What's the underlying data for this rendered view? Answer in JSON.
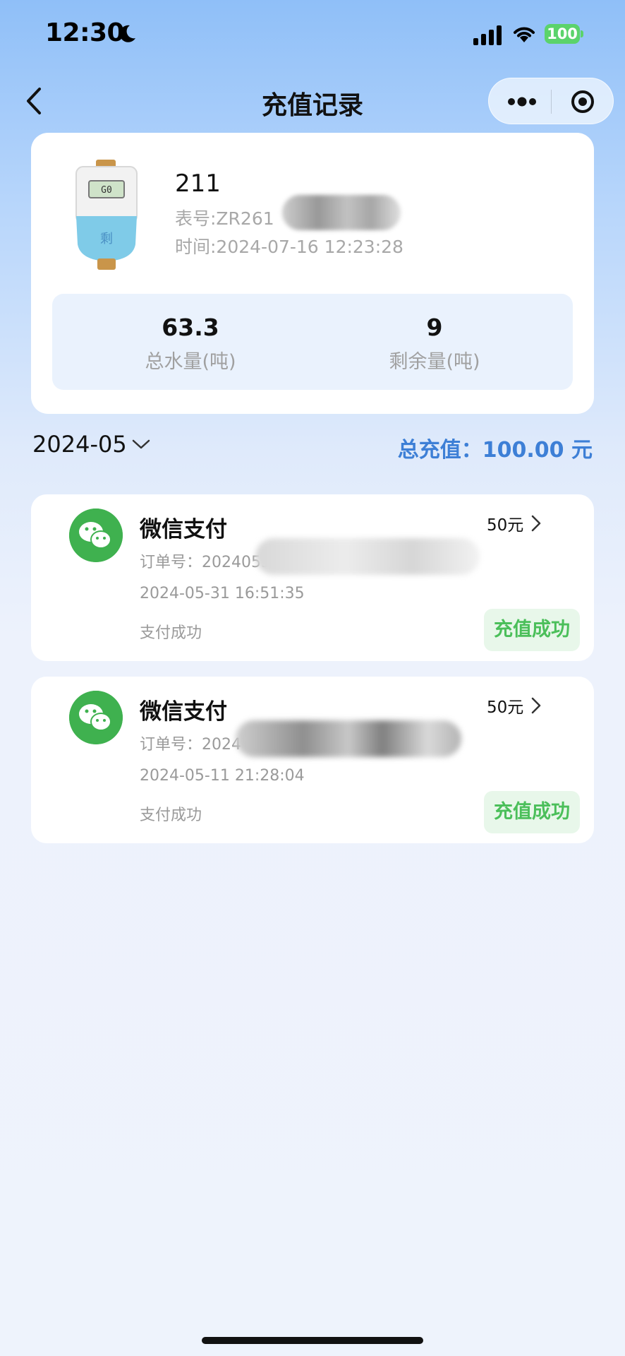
{
  "status_bar": {
    "time": "12:30",
    "battery": "100",
    "icons": [
      "moon-icon",
      "signal-icon",
      "wifi-icon",
      "battery-icon"
    ]
  },
  "nav": {
    "title": "充值记录",
    "back_icon": "chevron-left-icon",
    "more_icon": "more-dots-icon",
    "close_icon": "target-close-icon"
  },
  "meter": {
    "name": "211",
    "meter_no": "表号:ZR261",
    "time": "时间:2024-07-16 12:23:28",
    "total_water_value": "63.3",
    "total_water_label": "总水量(吨)",
    "remaining_value": "9",
    "remaining_label": "剩余量(吨)"
  },
  "filter": {
    "month": "2024-05",
    "total_recharge": "总充值：100.00 元"
  },
  "records": [
    {
      "title": "微信支付",
      "amount": "50元",
      "order": "订单号：2024053",
      "date": "2024-05-31 16:51:35",
      "pay_status": "支付成功",
      "badge": "充值成功"
    },
    {
      "title": "微信支付",
      "amount": "50元",
      "order": "订单号：2024",
      "date": "2024-05-11 21:28:04",
      "pay_status": "支付成功",
      "badge": "充值成功"
    }
  ],
  "colors": {
    "accent_blue": "#3d7fd6",
    "success_green": "#4bbf5a",
    "wechat_green": "#3fb14f"
  }
}
